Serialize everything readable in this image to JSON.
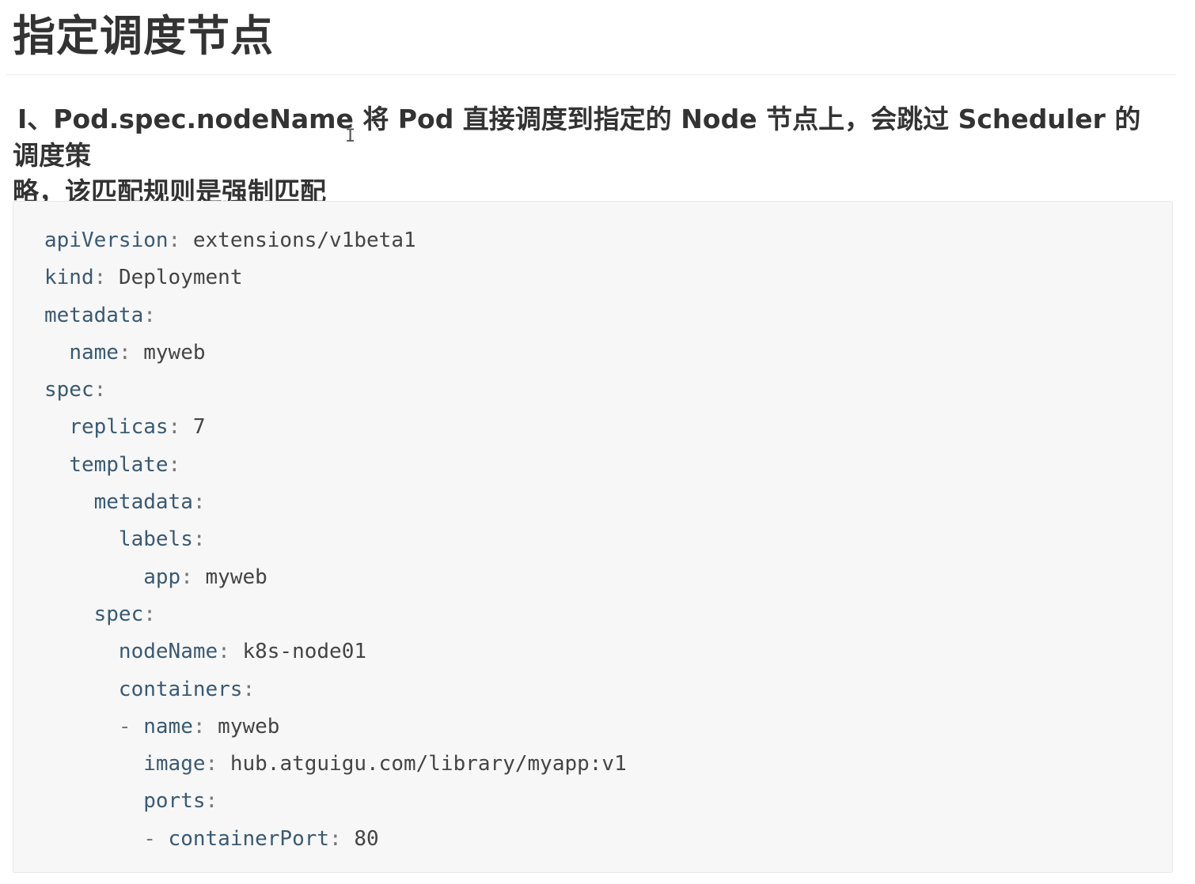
{
  "heading": {
    "title": "指定调度节点"
  },
  "paragraph": {
    "text_line1": "I、Pod.spec.nodeName 将 Pod 直接调度到指定的 Node 节点上，会跳过 Scheduler 的调度策",
    "text_line2": "略，该匹配规则是强制匹配"
  },
  "code": {
    "lines": [
      {
        "indent": "",
        "dash": "",
        "key": "apiVersion",
        "sep": ": ",
        "value": "extensions/v1beta1"
      },
      {
        "indent": "",
        "dash": "",
        "key": "kind",
        "sep": ": ",
        "value": "Deployment"
      },
      {
        "indent": "",
        "dash": "",
        "key": "metadata",
        "sep": ":",
        "value": ""
      },
      {
        "indent": "  ",
        "dash": "",
        "key": "name",
        "sep": ": ",
        "value": "myweb"
      },
      {
        "indent": "",
        "dash": "",
        "key": "spec",
        "sep": ":",
        "value": ""
      },
      {
        "indent": "  ",
        "dash": "",
        "key": "replicas",
        "sep": ": ",
        "value": "7"
      },
      {
        "indent": "  ",
        "dash": "",
        "key": "template",
        "sep": ":",
        "value": ""
      },
      {
        "indent": "    ",
        "dash": "",
        "key": "metadata",
        "sep": ":",
        "value": ""
      },
      {
        "indent": "      ",
        "dash": "",
        "key": "labels",
        "sep": ":",
        "value": ""
      },
      {
        "indent": "        ",
        "dash": "",
        "key": "app",
        "sep": ": ",
        "value": "myweb"
      },
      {
        "indent": "    ",
        "dash": "",
        "key": "spec",
        "sep": ":",
        "value": ""
      },
      {
        "indent": "      ",
        "dash": "",
        "key": "nodeName",
        "sep": ": ",
        "value": "k8s-node01"
      },
      {
        "indent": "      ",
        "dash": "",
        "key": "containers",
        "sep": ":",
        "value": ""
      },
      {
        "indent": "      ",
        "dash": "- ",
        "key": "name",
        "sep": ": ",
        "value": "myweb"
      },
      {
        "indent": "        ",
        "dash": "",
        "key": "image",
        "sep": ": ",
        "value": "hub.atguigu.com/library/myapp:v1"
      },
      {
        "indent": "        ",
        "dash": "",
        "key": "ports",
        "sep": ":",
        "value": ""
      },
      {
        "indent": "        ",
        "dash": "- ",
        "key": "containerPort",
        "sep": ": ",
        "value": "80"
      }
    ]
  }
}
